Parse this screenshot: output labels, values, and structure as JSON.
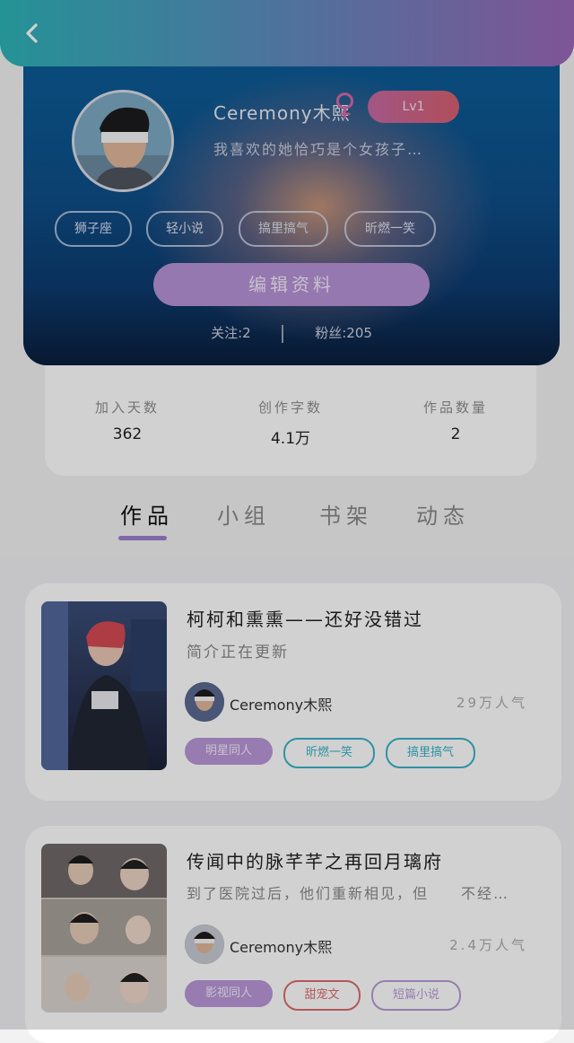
{
  "profile": {
    "username": "Ceremony木熙",
    "gender_symbol": "♀",
    "level": "Lv1",
    "signature": "我喜欢的她恰巧是个女孩子…",
    "tags": [
      "狮子座",
      "轻小说",
      "搞里搞气",
      "昕燃一笑"
    ],
    "edit_button": "编辑资料",
    "following": "关注:2",
    "followers": "粉丝:205"
  },
  "stats": [
    {
      "label": "加入天数",
      "value": "362"
    },
    {
      "label": "创作字数",
      "value": "4.1万"
    },
    {
      "label": "作品数量",
      "value": "2"
    }
  ],
  "tabs": [
    "作品",
    "小组",
    "书架",
    "动态"
  ],
  "works": [
    {
      "title": "柯柯和熏熏——还好没错过",
      "description": "简介正在更新",
      "author": "Ceremony木熙",
      "popularity": "29万人气",
      "tags": [
        "明星同人",
        "昕燃一笑",
        "搞里搞气"
      ]
    },
    {
      "title": "传闻中的脉芊芊之再回月璃府",
      "description": "到了医院过后，他们重新相见，但　　不经…",
      "author": "Ceremony木熙",
      "popularity": "2.4万人气",
      "tags": [
        "影视同人",
        "甜宠文",
        "短篇小说"
      ]
    }
  ],
  "colors": {
    "accent": "#9c7fd0",
    "topbar_start": "#2db3b8",
    "topbar_end": "#9a68b8"
  }
}
